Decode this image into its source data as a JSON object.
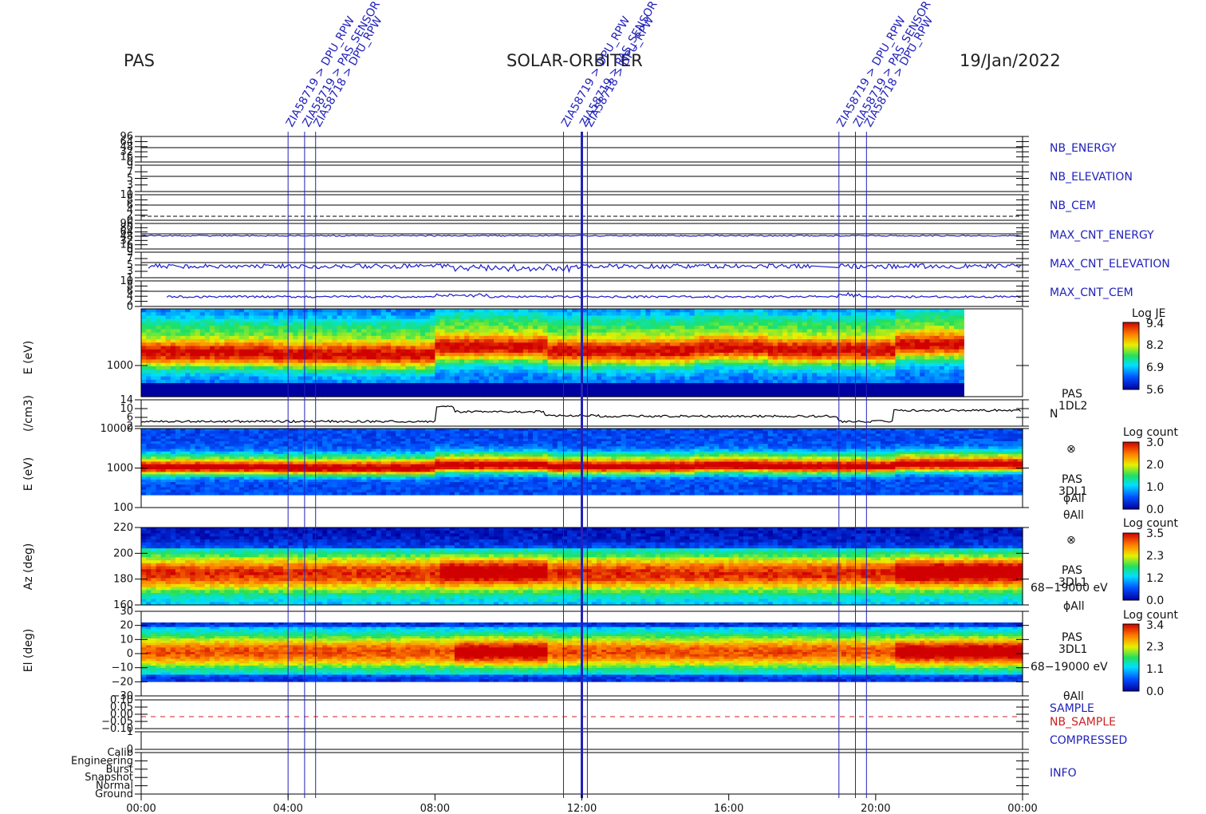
{
  "header": {
    "instrument": "PAS",
    "mission": "SOLAR-ORBITER",
    "date": "19/Jan/2022"
  },
  "events": [
    {
      "time": 4.0,
      "label": "ZIA58719 > DPU_RPW"
    },
    {
      "time": 4.45,
      "label": "ZIA58719 > PAS_SENSOR"
    },
    {
      "time": 4.75,
      "label": "ZIA58718 > DPU_RPW"
    },
    {
      "time": 11.5,
      "label": "ZIA58719 > DPU_RPW"
    },
    {
      "time": 12.0,
      "label": "ZIA58719 > PAS_SENSOR"
    },
    {
      "time": 12.15,
      "label": "ZIA58718 > DPU_RPW"
    },
    {
      "time": 19.0,
      "label": "ZIA58719 > DPU_RPW"
    },
    {
      "time": 19.45,
      "label": "ZIA58719 > PAS_SENSOR"
    },
    {
      "time": 19.75,
      "label": "ZIA58718 > DPU_RPW"
    }
  ],
  "panel_labels": {
    "nb_energy": "NB_ENERGY",
    "nb_elevation": "NB_ELEVATION",
    "nb_cem": "NB_CEM",
    "max_cnt_energy": "MAX_CNT_ENERGY",
    "max_cnt_elevation": "MAX_CNT_ELEVATION",
    "max_cnt_cem": "MAX_CNT_CEM",
    "pas": "PAS",
    "dl2": "1DL2",
    "n": "N",
    "dl1": "3DL1",
    "phi_all": "ϕAll",
    "theta_all": "θAll",
    "energy_range": "68−19000 eV",
    "sample": "SAMPLE",
    "nb_sample": "NB_SAMPLE",
    "compressed": "COMPRESSED",
    "info": "INFO",
    "otimes": "⊗"
  },
  "axes": {
    "e_ev": "E (eV)",
    "n_cm3": "(/cm3)",
    "az_deg": "Az (deg)",
    "el_deg": "El (deg)"
  },
  "colorbars": [
    {
      "title": "Log JE",
      "ticks": [
        "9.4",
        "8.2",
        "6.9",
        "5.6"
      ]
    },
    {
      "title": "Log count",
      "ticks": [
        "3.0",
        "2.0",
        "1.0",
        "0.0"
      ]
    },
    {
      "title": "Log count",
      "ticks": [
        "3.5",
        "2.3",
        "1.2",
        "0.0"
      ]
    },
    {
      "title": "Log count",
      "ticks": [
        "3.4",
        "2.3",
        "1.1",
        "0.0"
      ]
    }
  ],
  "colors": {
    "axis": "#000000",
    "event_line": "#2222bb",
    "trace_blue": "#1a1acc",
    "red_label": "#cc2222"
  },
  "chart_data": {
    "type": "heatmap",
    "x_ticks": [
      "00:00",
      "04:00",
      "08:00",
      "12:00",
      "16:00",
      "20:00",
      "00:00"
    ],
    "xlim_hours": [
      0,
      24
    ],
    "panels": [
      {
        "name": "NB_ENERGY",
        "type": "line",
        "y_ticks": [
          "96",
          "64",
          "48",
          "32",
          "16",
          "0"
        ]
      },
      {
        "name": "NB_ELEVATION",
        "type": "line",
        "y_ticks": [
          "9",
          "7",
          "5",
          "3",
          "1"
        ]
      },
      {
        "name": "NB_CEM",
        "type": "line",
        "y_ticks": [
          "10",
          "8",
          "6",
          "4",
          "2",
          "0"
        ]
      },
      {
        "name": "MAX_CNT_ENERGY",
        "type": "line",
        "y_ticks": [
          "96",
          "80",
          "64",
          "48",
          "32",
          "16",
          "0"
        ]
      },
      {
        "name": "MAX_CNT_ELEVATION",
        "type": "line",
        "y_ticks": [
          "9",
          "7",
          "5",
          "3",
          "1"
        ]
      },
      {
        "name": "MAX_CNT_CEM",
        "type": "line",
        "y_ticks": [
          "10",
          "8",
          "6",
          "4",
          "2",
          "0"
        ]
      },
      {
        "name": "PAS 1DL2 Energy spectrogram",
        "type": "heatmap",
        "ylabel": "E (eV)",
        "y_ticks": [
          "1000"
        ],
        "z_label": "Log JE",
        "zlim": [
          5.6,
          9.4
        ],
        "data_end_hours": 22.3
      },
      {
        "name": "PAS 1DL2 N",
        "type": "line",
        "ylabel": "(/cm3)",
        "y_ticks": [
          "14",
          "10",
          "6",
          "2"
        ]
      },
      {
        "name": "PAS 3DL1 E",
        "type": "heatmap",
        "ylabel": "E (eV)",
        "y_ticks": [
          "10000",
          "1000",
          "100"
        ],
        "z_label": "Log count",
        "zlim": [
          0.0,
          3.0
        ]
      },
      {
        "name": "PAS 3DL1 Az",
        "type": "heatmap",
        "ylabel": "Az (deg)",
        "y_ticks": [
          "220",
          "200",
          "180",
          "160"
        ],
        "z_label": "Log count",
        "zlim": [
          0.0,
          3.5
        ]
      },
      {
        "name": "PAS 3DL1 El",
        "type": "heatmap",
        "ylabel": "El (deg)",
        "y_ticks": [
          "30",
          "20",
          "10",
          "0",
          "−10",
          "−20",
          "−30"
        ],
        "z_label": "Log count",
        "zlim": [
          0.0,
          3.4
        ]
      },
      {
        "name": "SAMPLE / NB_SAMPLE",
        "type": "line",
        "y_ticks": [
          "0.10",
          "0.05",
          "0.00",
          "−0.05",
          "−0.10"
        ]
      },
      {
        "name": "COMPRESSED",
        "type": "line",
        "y_ticks": [
          "1",
          "0"
        ]
      },
      {
        "name": "INFO",
        "type": "line",
        "y_ticks": [
          "Calib",
          "Engineering",
          "Burst",
          "Snapshot",
          "Normal",
          "Ground"
        ]
      }
    ]
  }
}
